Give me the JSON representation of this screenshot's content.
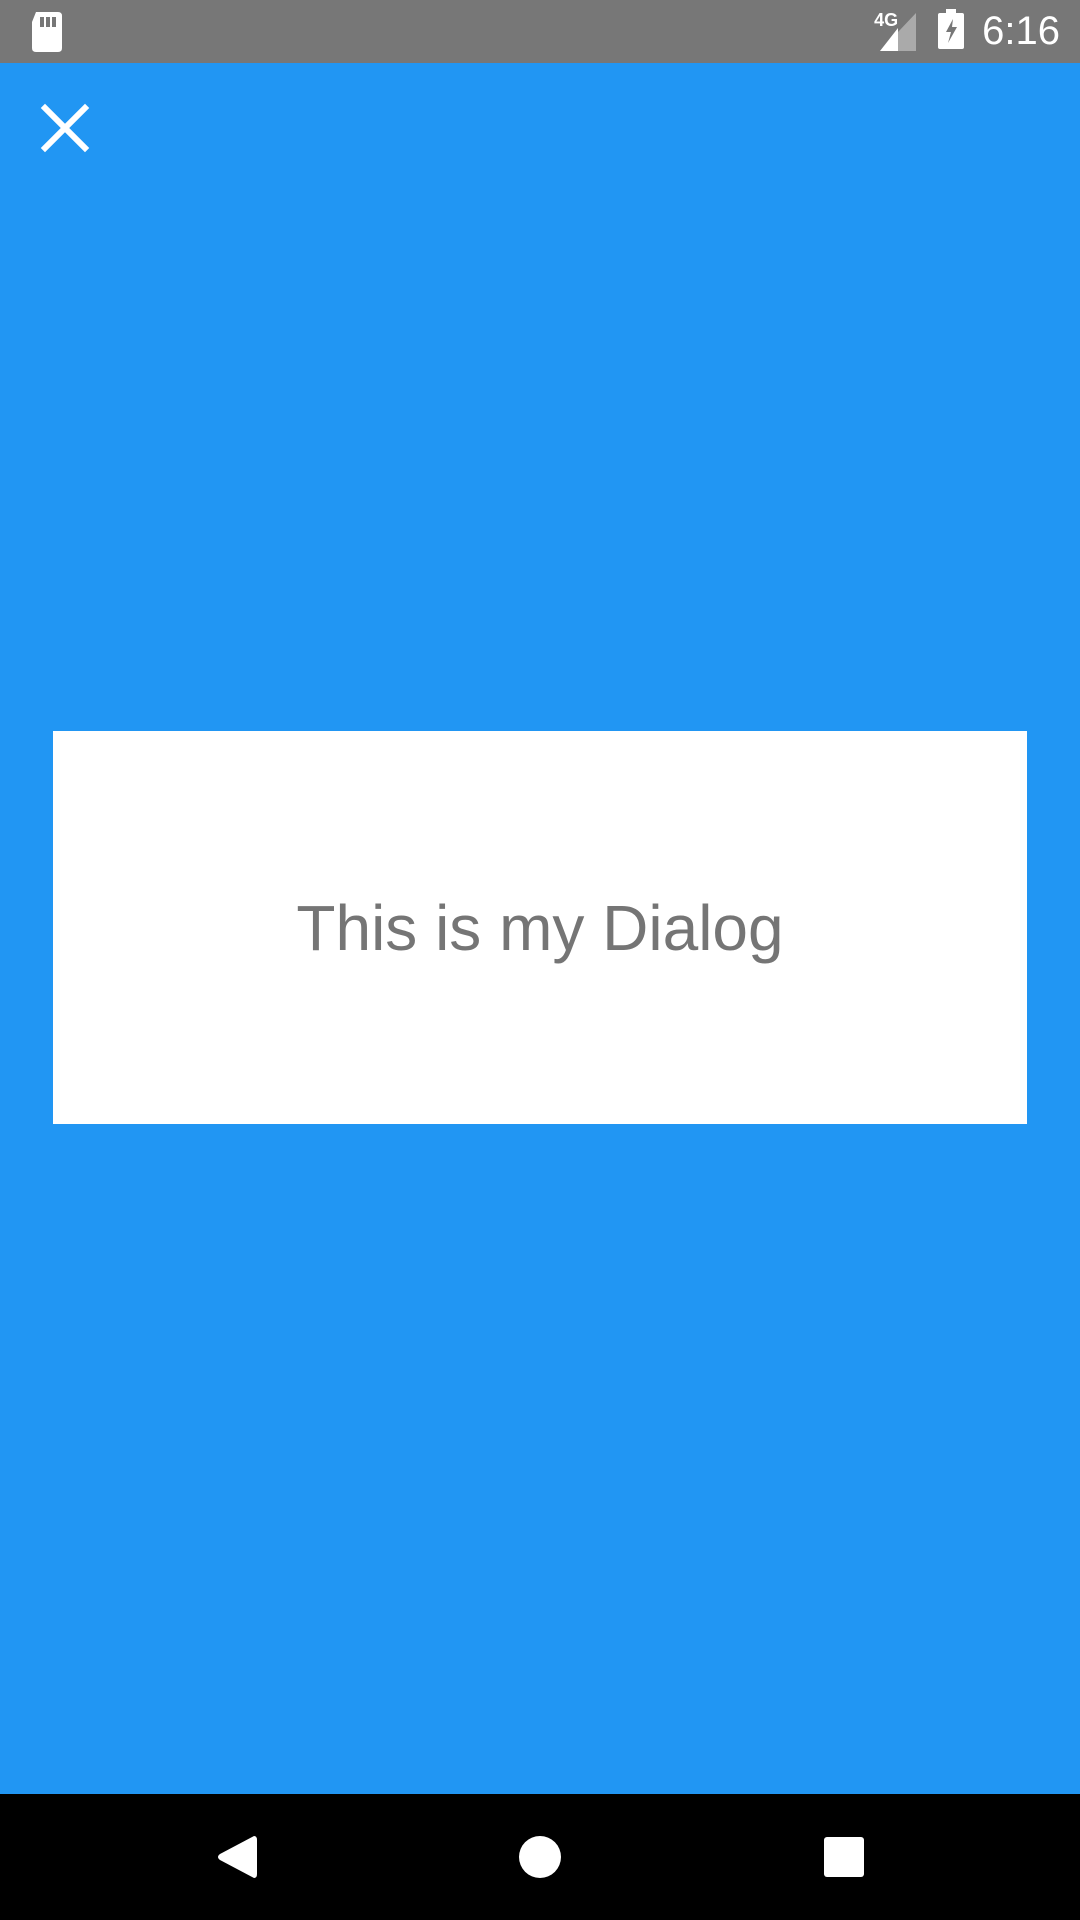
{
  "status_bar": {
    "network_label": "4G",
    "time": "6:16",
    "icons": {
      "left": "sd-card-icon",
      "signal": "signal-icon",
      "battery": "battery-charging-icon"
    }
  },
  "app": {
    "close_icon": "close-icon"
  },
  "dialog": {
    "text": "This is my Dialog"
  },
  "navigation": {
    "back_icon": "back-icon",
    "home_icon": "home-icon",
    "recent_icon": "recent-apps-icon"
  },
  "colors": {
    "status_bar_bg": "#777777",
    "app_bg": "#2196F3",
    "dialog_bg": "#FFFFFF",
    "dialog_text": "#757575",
    "nav_bar_bg": "#000000",
    "icon_fg": "#FFFFFF"
  }
}
